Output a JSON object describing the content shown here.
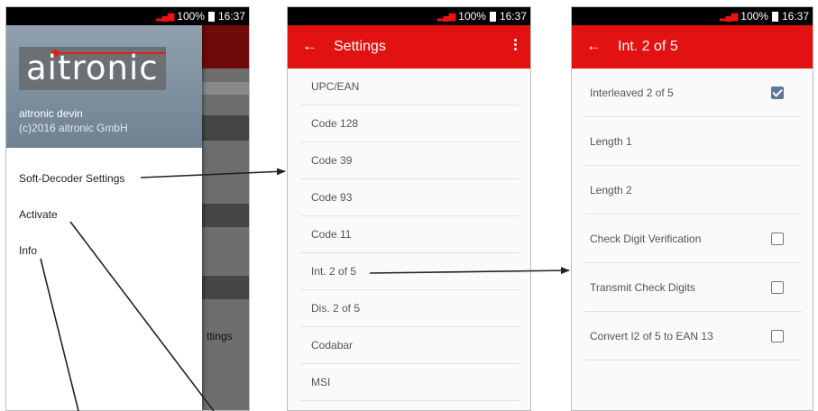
{
  "status_bar": {
    "battery": "100%",
    "time": "16:37"
  },
  "screen1": {
    "logo_text": "aitronic",
    "user_name": "aitronic devin",
    "copyright": "(c)2016 aitronic GmbH",
    "menu": [
      "Soft-Decoder Settings",
      "Activate",
      "Info"
    ],
    "background_partial_text": "ttings"
  },
  "screen2": {
    "title": "Settings",
    "items": [
      "UPC/EAN",
      "Code 128",
      "Code 39",
      "Code 93",
      "Code 11",
      "Int. 2 of 5",
      "Dis. 2 of 5",
      "Codabar",
      "MSI"
    ]
  },
  "screen3": {
    "title": "Int. 2 of 5",
    "items": [
      {
        "label": "Interleaved 2 of 5",
        "checked": true
      },
      {
        "label": "Length 1",
        "checked": null
      },
      {
        "label": "Length 2",
        "checked": null
      },
      {
        "label": "Check Digit Verification",
        "checked": false
      },
      {
        "label": "Transmit Check Digits",
        "checked": false
      },
      {
        "label": "Convert I2 of 5 to EAN 13",
        "checked": false
      }
    ]
  },
  "colors": {
    "accent_red": "#e31212",
    "checkbox_checked": "#5b7a97"
  }
}
